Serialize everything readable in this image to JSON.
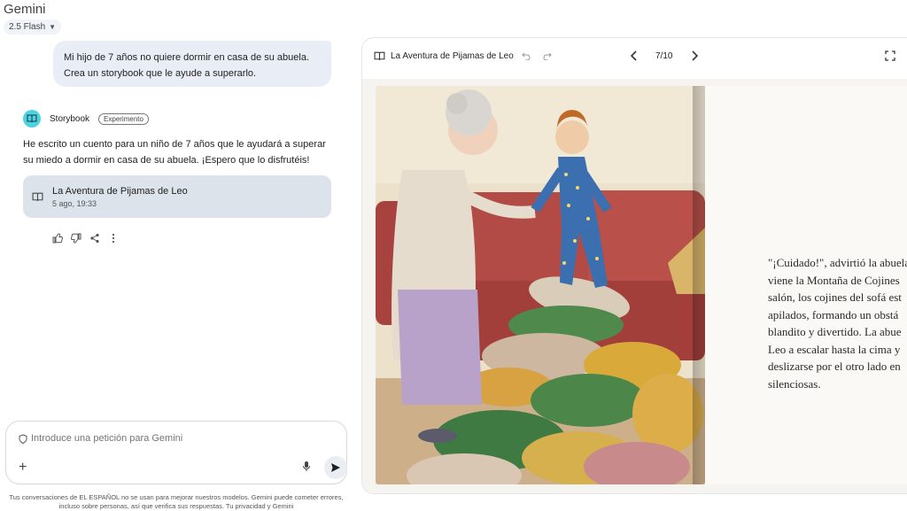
{
  "app": {
    "title": "Gemini",
    "model": "2.5 Flash"
  },
  "user_message": "Mi hijo de 7 años no quiere dormir en casa de su abuela. Crea un storybook que le ayude a superarlo.",
  "assistant": {
    "name": "Storybook",
    "badge": "Experimento",
    "message": "He escrito un cuento para un niño de 7 años que le ayudará a superar su miedo a dormir en casa de su abuela. ¡Espero que lo disfrutéis!",
    "card": {
      "title": "La Aventura de Pijamas de Leo",
      "date": "5 ago, 19:33"
    }
  },
  "prompt": {
    "placeholder": "Introduce una petición para Gemini"
  },
  "disclaimer": "Tus conversaciones de EL ESPAÑOL no se usan para mejorar nuestros modelos. Gemini puede cometer errores, incluso sobre personas, así que verifica sus respuestas. Tu privacidad y Gemini",
  "canvas": {
    "title": "La Aventura de Pijamas de Leo",
    "page_indicator": "7/10",
    "story_text": "\"¡Cuidado!\", advirtió la abuela\nviene la Montaña de Cojines\nsalón, los cojines del sofá est\napilados, formando un obstá\nblandito y divertido. La abue\nLeo a escalar hasta la cima y\ndeslizarse por el otro lado en\nsilenciosas."
  },
  "colors": {
    "accent": "#4fd1e0",
    "bubble": "#e9eef6",
    "card": "#dde3ea",
    "sofa": "#b94a48",
    "wall": "#e9ddc4"
  },
  "icons": [
    "chevron-down-icon",
    "book-icon",
    "thumbs-up-icon",
    "thumbs-down-icon",
    "share-icon",
    "more-icon",
    "shield-icon",
    "plus-icon",
    "mic-icon",
    "send-icon",
    "undo-icon",
    "redo-icon",
    "chevron-left-icon",
    "chevron-right-icon",
    "fullscreen-icon"
  ]
}
